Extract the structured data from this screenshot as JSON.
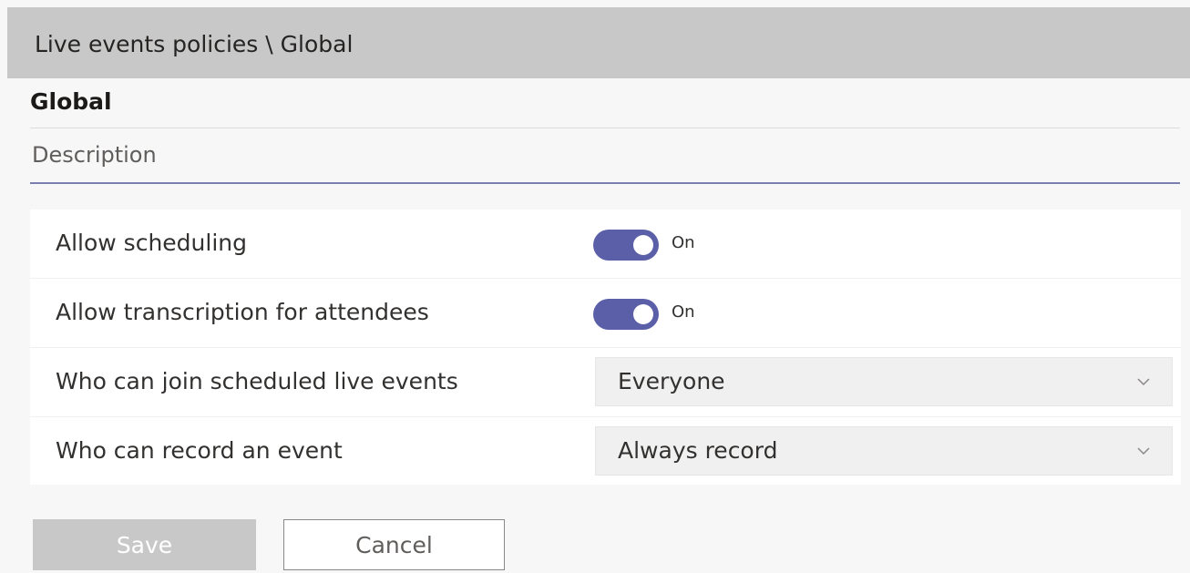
{
  "header": {
    "breadcrumb": "Live events policies \\ Global"
  },
  "page": {
    "title": "Global",
    "description_placeholder": "Description"
  },
  "settings": [
    {
      "label": "Allow scheduling",
      "type": "toggle",
      "state_text": "On",
      "enabled": true
    },
    {
      "label": "Allow transcription for attendees",
      "type": "toggle",
      "state_text": "On",
      "enabled": true
    },
    {
      "label": "Who can join scheduled live events",
      "type": "dropdown",
      "value": "Everyone"
    },
    {
      "label": "Who can record an event",
      "type": "dropdown",
      "value": "Always record"
    }
  ],
  "actions": {
    "save_label": "Save",
    "cancel_label": "Cancel"
  },
  "colors": {
    "toggle_on": "#5b5fa8",
    "header_bar": "#c8c8c8",
    "save_disabled": "#c8c8c8"
  },
  "icons": {
    "dropdown_indicator": "chevron-down-icon"
  }
}
